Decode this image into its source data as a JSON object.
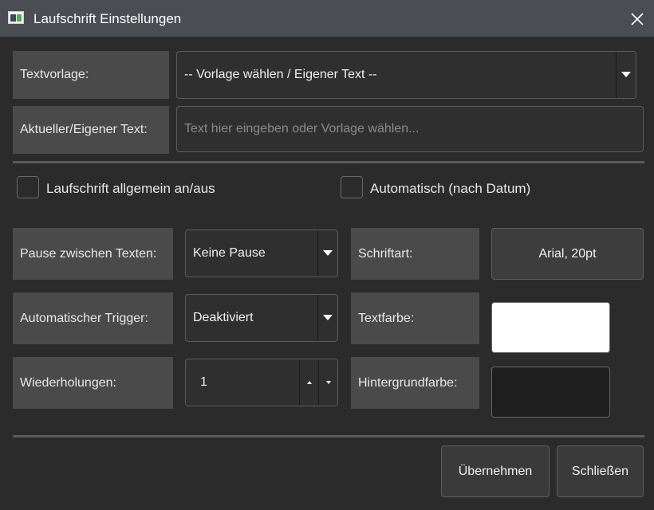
{
  "window": {
    "title": "Laufschrift Einstellungen",
    "icon": "app-window-icon",
    "close_icon": "close-icon"
  },
  "template": {
    "label": "Textvorlage:",
    "selected": "-- Vorlage wählen / Eigener Text --"
  },
  "custom_text": {
    "label": "Aktueller/Eigener Text:",
    "value": "",
    "placeholder": "Text hier eingeben oder Vorlage wählen..."
  },
  "checkboxes": {
    "general_label": "Laufschrift allgemein an/aus",
    "general_checked": false,
    "auto_label": "Automatisch (nach Datum)",
    "auto_checked": false
  },
  "pause": {
    "label": "Pause zwischen Texten:",
    "selected": "Keine Pause"
  },
  "trigger": {
    "label": "Automatischer Trigger:",
    "selected": "Deaktiviert"
  },
  "repeats": {
    "label": "Wiederholungen:",
    "value": "1"
  },
  "font": {
    "label": "Schriftart:",
    "button": "Arial, 20pt"
  },
  "text_color": {
    "label": "Textfarbe:",
    "color": "#ffffff"
  },
  "bg_color": {
    "label": "Hintergrundfarbe:",
    "color": "#1e1e1e"
  },
  "buttons": {
    "apply": "Übernehmen",
    "close": "Schließen"
  }
}
